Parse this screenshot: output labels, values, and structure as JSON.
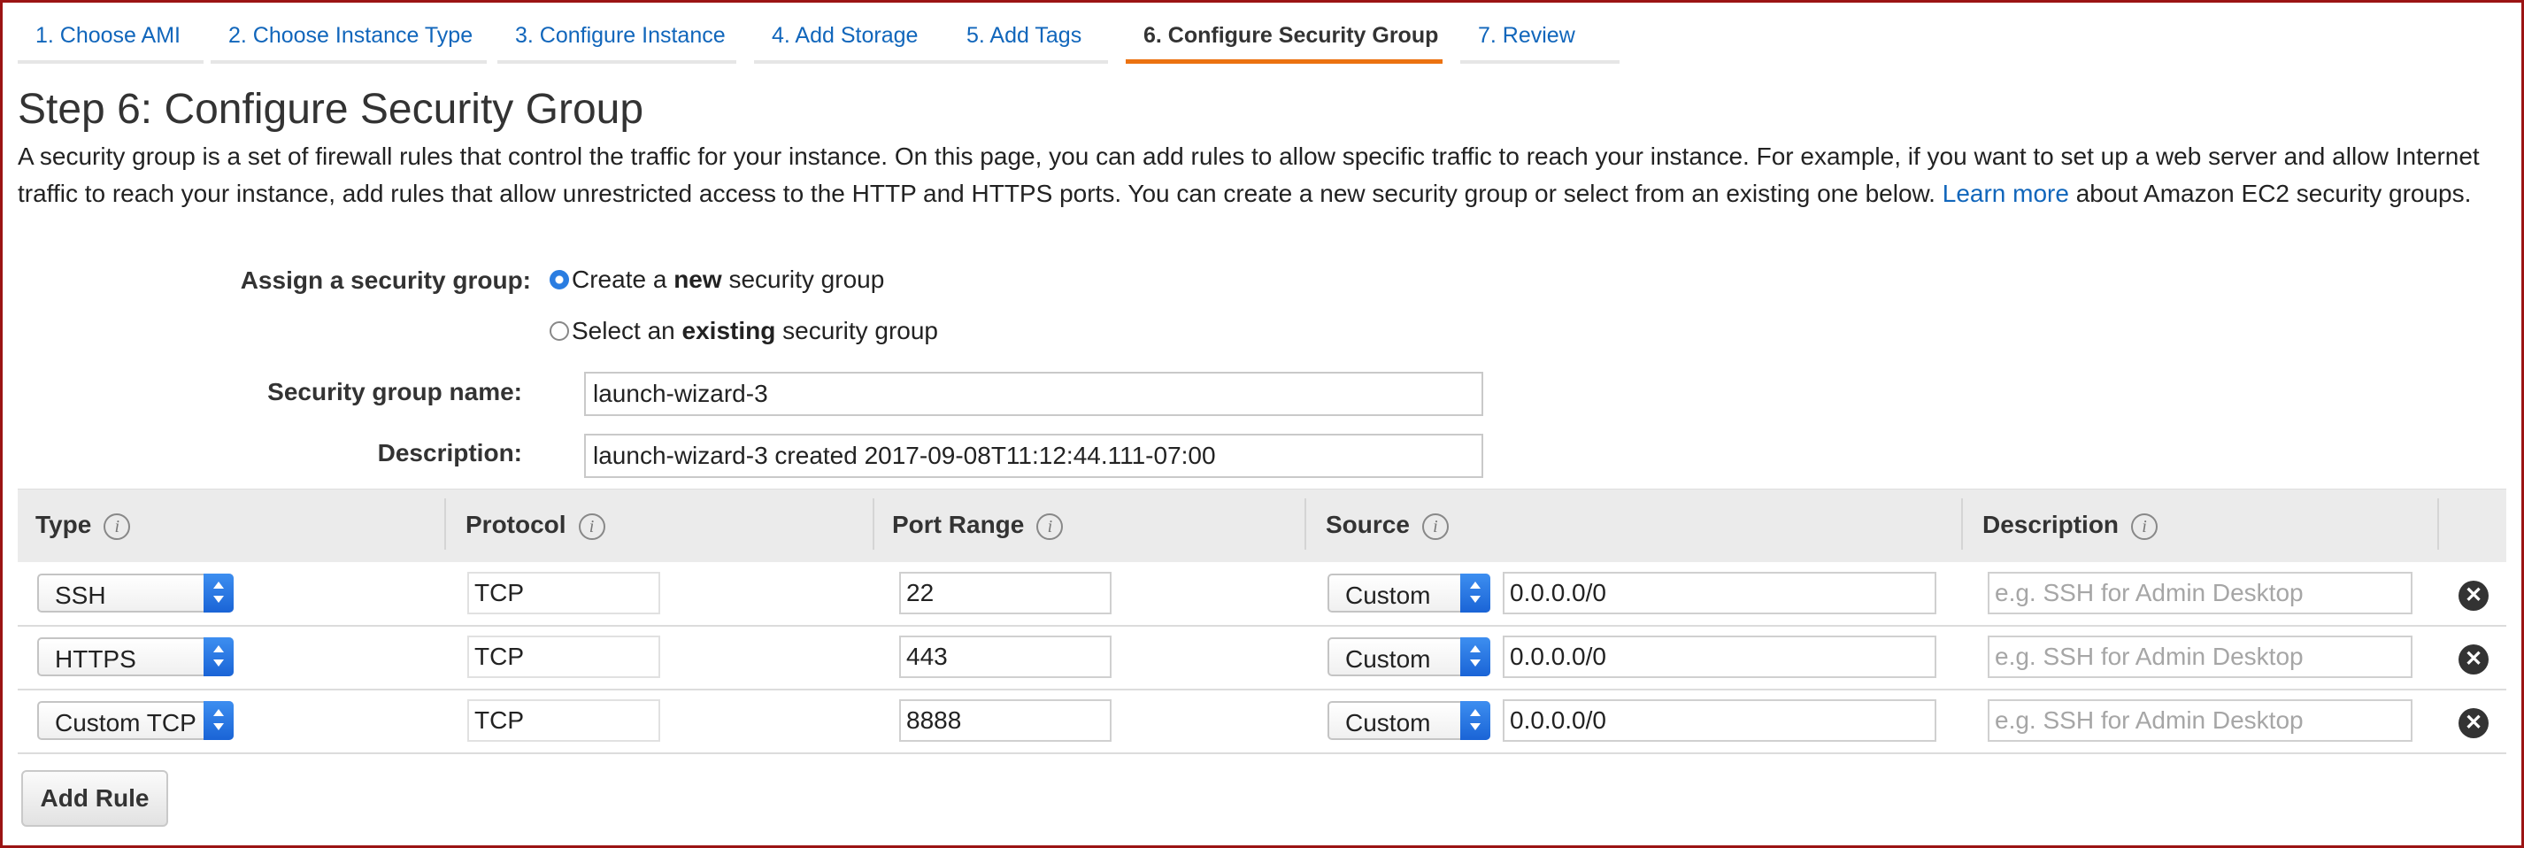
{
  "steps": [
    {
      "label": "1. Choose AMI"
    },
    {
      "label": "2. Choose Instance Type"
    },
    {
      "label": "3. Configure Instance"
    },
    {
      "label": "4. Add Storage"
    },
    {
      "label": "5. Add Tags"
    },
    {
      "label": "6. Configure Security Group",
      "active": true
    },
    {
      "label": "7. Review"
    }
  ],
  "page": {
    "title": "Step 6: Configure Security Group",
    "intro_before_link": "A security group is a set of firewall rules that control the traffic for your instance. On this page, you can add rules to allow specific traffic to reach your instance. For example, if you want to set up a web server and allow Internet traffic to reach your instance, add rules that allow unrestricted access to the HTTP and HTTPS ports. You can create a new security group or select from an existing one below.",
    "intro_link": "Learn more",
    "intro_after_link": "about Amazon EC2 security groups."
  },
  "form": {
    "assign_label": "Assign a security group:",
    "create_new": {
      "prefix": "Create a",
      "bold": "new",
      "suffix": "security group",
      "selected": true
    },
    "select_existing": {
      "prefix": "Select an",
      "bold": "existing",
      "suffix": "security group",
      "selected": false
    },
    "name_label": "Security group name:",
    "name_value": "launch-wizard-3",
    "description_label": "Description:",
    "description_value": "launch-wizard-3 created 2017-09-08T11:12:44.111-07:00"
  },
  "table": {
    "headers": {
      "type": "Type",
      "protocol": "Protocol",
      "port_range": "Port Range",
      "source": "Source",
      "description": "Description"
    },
    "info_glyph": "i",
    "remove_glyph": "✕",
    "description_placeholder": "e.g. SSH for Admin Desktop",
    "rows": [
      {
        "type": "SSH",
        "protocol": "TCP",
        "port": "22",
        "source_type": "Custom",
        "source": "0.0.0.0/0"
      },
      {
        "type": "HTTPS",
        "protocol": "TCP",
        "port": "443",
        "source_type": "Custom",
        "source": "0.0.0.0/0"
      },
      {
        "type": "Custom TCP",
        "protocol": "TCP",
        "port": "8888",
        "source_type": "Custom",
        "source": "0.0.0.0/0"
      }
    ]
  },
  "actions": {
    "add_rule": "Add Rule"
  },
  "colors": {
    "link": "#1166bb",
    "active_tab_underline": "#ec7211",
    "select_button": "#2a7de1",
    "frame_border": "#9b1414"
  }
}
